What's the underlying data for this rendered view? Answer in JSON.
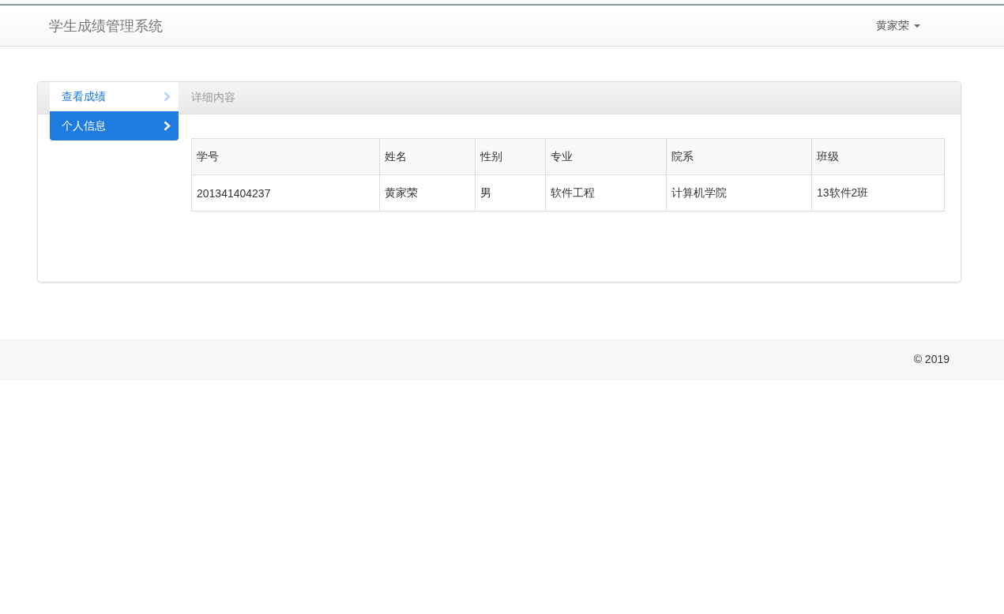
{
  "navbar": {
    "brand": "学生成绩管理系统",
    "user": "黄家荣"
  },
  "sidebar": {
    "items": [
      {
        "label": "查看成绩",
        "selected": false
      },
      {
        "label": "个人信息",
        "selected": true
      }
    ]
  },
  "panel": {
    "title": "详细内容"
  },
  "table": {
    "columns": [
      "学号",
      "姓名",
      "性别",
      "专业",
      "院系",
      "班级"
    ],
    "rows": [
      [
        "201341404237",
        "黄家荣",
        "男",
        "软件工程",
        "计算机学院",
        "13软件2班"
      ]
    ]
  },
  "footer": {
    "text": "© 2019"
  }
}
